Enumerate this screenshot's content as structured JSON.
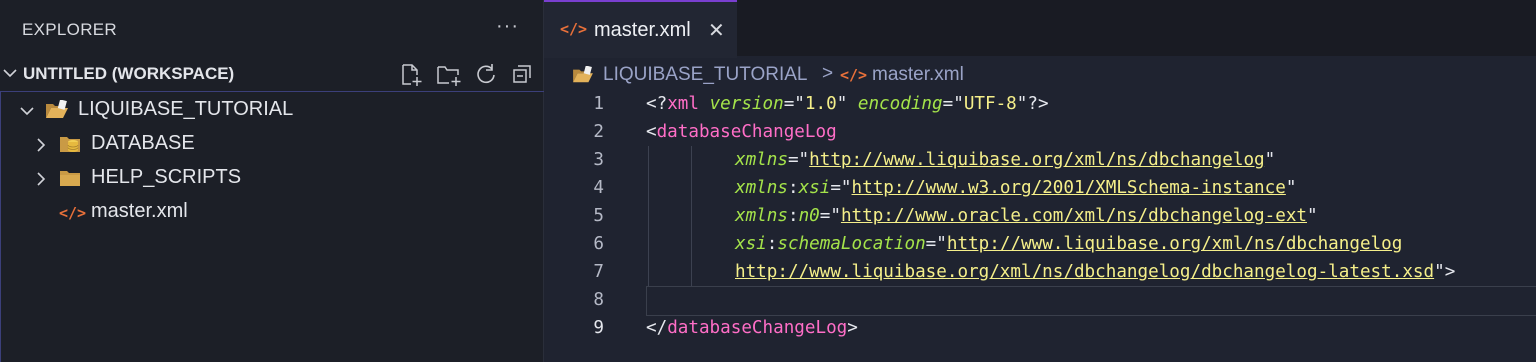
{
  "explorer": {
    "title": "EXPLORER",
    "more_label": "···",
    "workspace": {
      "title": "UNTITLED (WORKSPACE)",
      "actions": [
        "new-file-icon",
        "new-folder-icon",
        "refresh-icon",
        "collapse-all-icon"
      ]
    },
    "tree": [
      {
        "label": "LIQUIBASE_TUTORIAL",
        "type": "open-folder",
        "expanded": true
      },
      {
        "label": "DATABASE",
        "type": "folder",
        "expanded": false
      },
      {
        "label": "HELP_SCRIPTS",
        "type": "folder",
        "expanded": false
      },
      {
        "label": "master.xml",
        "type": "xml-file"
      }
    ]
  },
  "tabs": [
    {
      "label": "master.xml",
      "icon": "xml-icon",
      "icon_text": "</>",
      "close": "✕",
      "active": true
    }
  ],
  "breadcrumb": {
    "segments": [
      "LIQUIBASE_TUTORIAL",
      "master.xml"
    ],
    "separator": ">"
  },
  "editor": {
    "line_numbers": [
      "1",
      "2",
      "3",
      "4",
      "5",
      "6",
      "7",
      "8",
      "9"
    ],
    "code": {
      "l1": {
        "open": "<?",
        "tag": "xml",
        "attr1": "version",
        "eq1": "=\"",
        "val1": "1.0",
        "q1": "\"",
        "attr2": "encoding",
        "eq2": "=\"",
        "val2": "UTF-8",
        "close": "\"?>"
      },
      "l2": {
        "open": "<",
        "tag": "databaseChangeLog"
      },
      "l3": {
        "attr": "xmlns",
        "eq": "=\"",
        "url": "http://www.liquibase.org/xml/ns/dbchangelog",
        "q": "\""
      },
      "l4": {
        "attr_a": "xmlns",
        "colon": ":",
        "attr_b": "xsi",
        "eq": "=\"",
        "url": "http://www.w3.org/2001/XMLSchema-instance",
        "q": "\""
      },
      "l5": {
        "attr_a": "xmlns",
        "colon": ":",
        "attr_b": "n0",
        "eq": "=\"",
        "url": "http://www.oracle.com/xml/ns/dbchangelog-ext",
        "q": "\""
      },
      "l6": {
        "attr_a": "xsi",
        "colon": ":",
        "attr_b": "schemaLocation",
        "eq": "=\"",
        "url": "http://www.liquibase.org/xml/ns/dbchangelog"
      },
      "l7": {
        "url": "http://www.liquibase.org/xml/ns/dbchangelog/dbchangelog-latest.xsd",
        "close": "\">"
      },
      "l9": {
        "open": "</",
        "tag": "databaseChangeLog",
        "close": ">"
      }
    }
  },
  "colors": {
    "tag": "#ff6ec7",
    "attribute": "#a4e34a",
    "string": "#f5ef8a",
    "xml_icon": "#e8703a",
    "active_tab_border": "#7a3fd0"
  }
}
